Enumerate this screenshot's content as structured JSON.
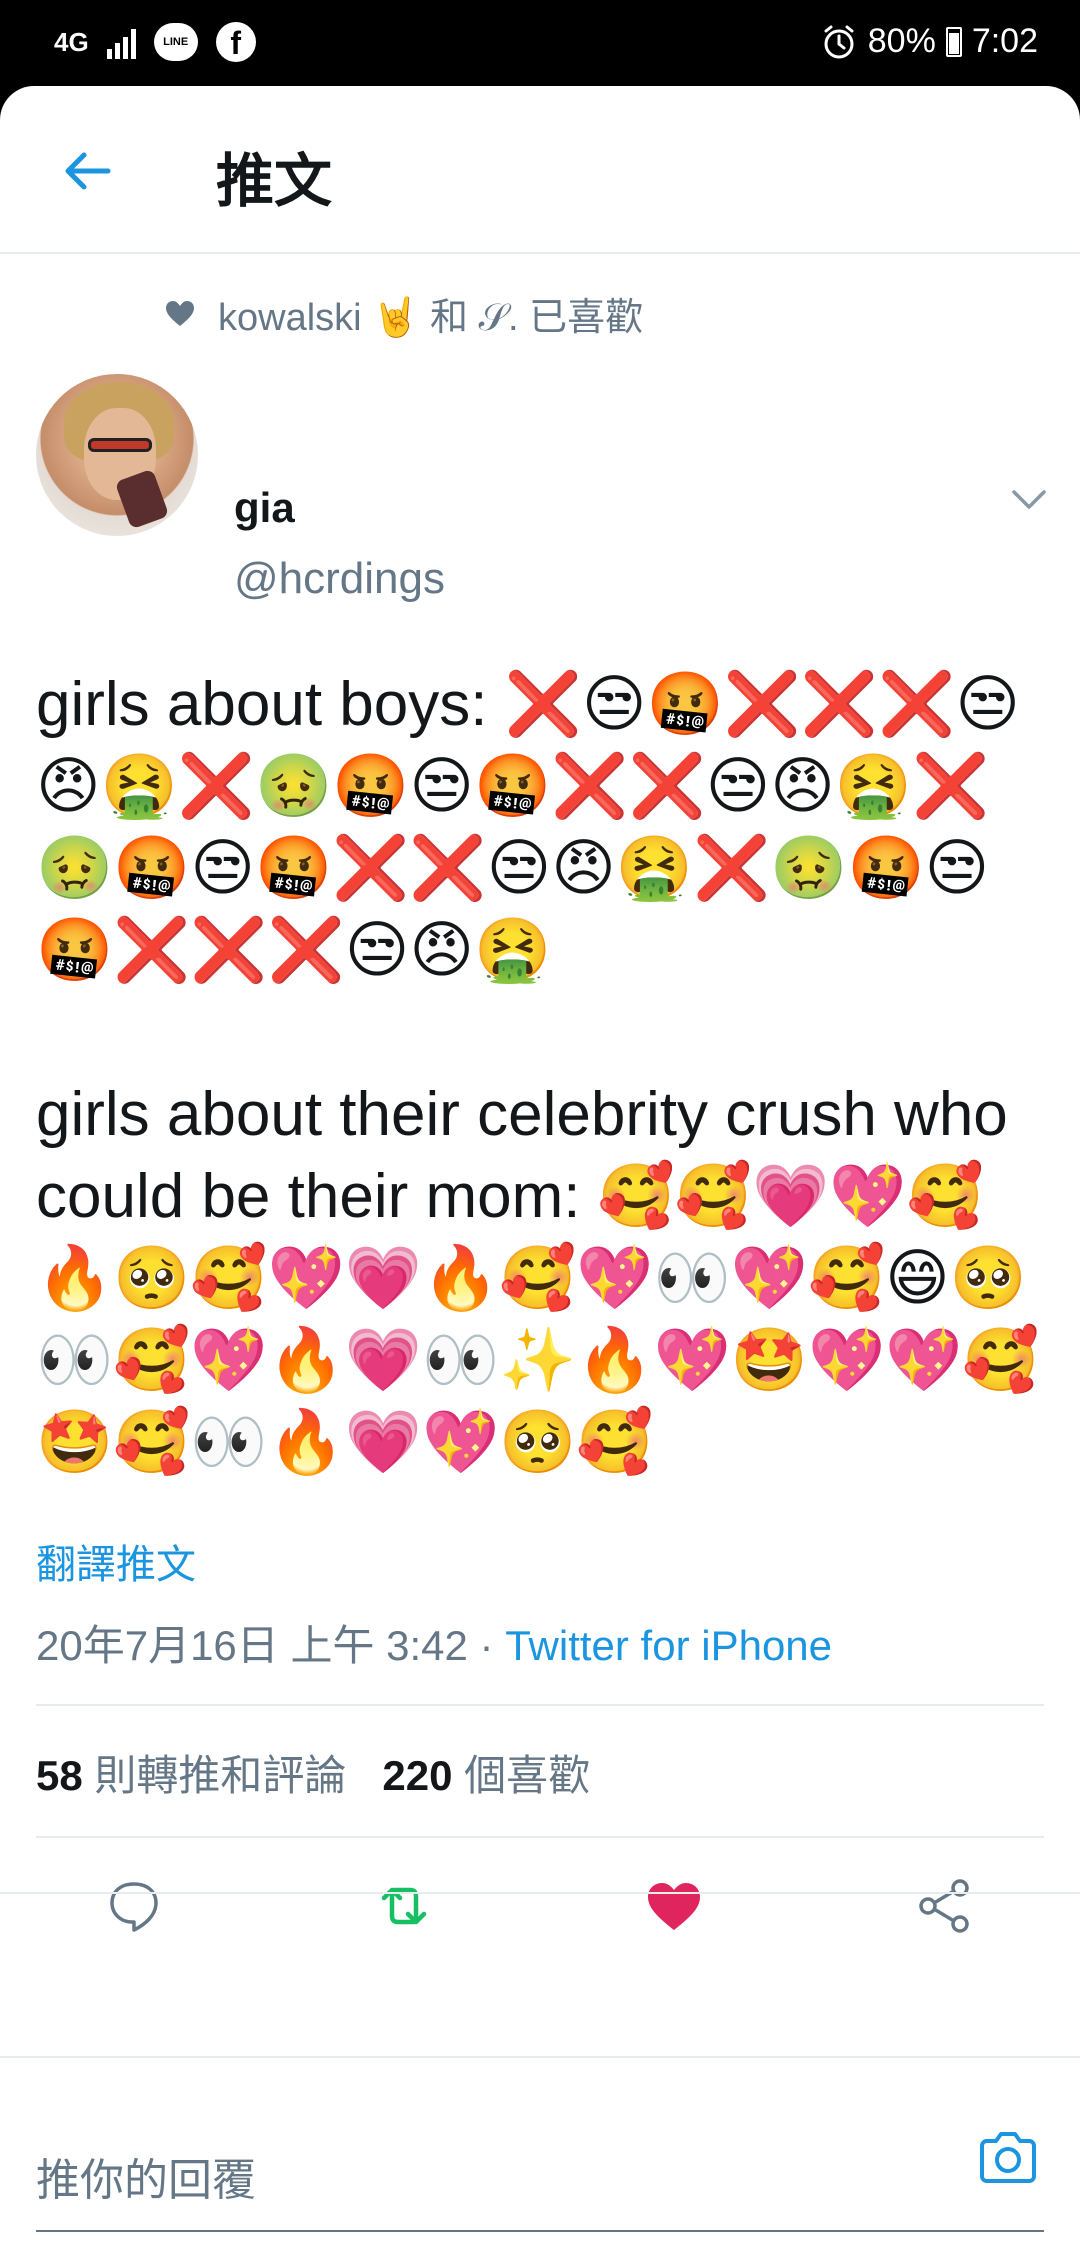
{
  "status_bar": {
    "network": "4G",
    "battery": "80%",
    "time": "7:02",
    "icons": [
      "signal-icon",
      "line-icon",
      "facebook-icon",
      "alarm-icon",
      "battery-icon"
    ]
  },
  "header": {
    "title": "推文",
    "back_icon": "back-arrow-icon"
  },
  "social_context": {
    "text": "kowalski 🤘 和 𝒮. 已喜歡"
  },
  "author": {
    "name": "gia",
    "handle": "@hcrdings"
  },
  "tweet": {
    "text": "girls about boys: ❌😒🤬❌❌❌😒😠🤮❌🤢🤬😒🤬❌❌😒😠🤮❌🤢🤬😒🤬❌❌😒😠🤮❌🤢🤬😒🤬❌❌❌😒😠🤮\n\ngirls about their celebrity crush who could be their mom: 🥰🥰💗💖🥰🔥🥺🥰💖💗🔥🥰💖👀💖🥰😄🥺👀🥰💖🔥💗👀✨🔥💖🤩💖💖🥰🤩🥰👀🔥💗💖🥺🥰"
  },
  "translate_label": "翻譯推文",
  "meta": {
    "timestamp": "20年7月16日 上午 3:42 · ",
    "source": "Twitter for iPhone"
  },
  "stats": {
    "retweets_count": "58",
    "retweets_label": "則轉推和評論",
    "likes_count": "220",
    "likes_label": "個喜歡"
  },
  "colors": {
    "accent": "#1b95e0",
    "retweet": "#17bf63",
    "like": "#e0245e",
    "muted": "#657786"
  },
  "reply": {
    "placeholder": "推你的回覆"
  }
}
